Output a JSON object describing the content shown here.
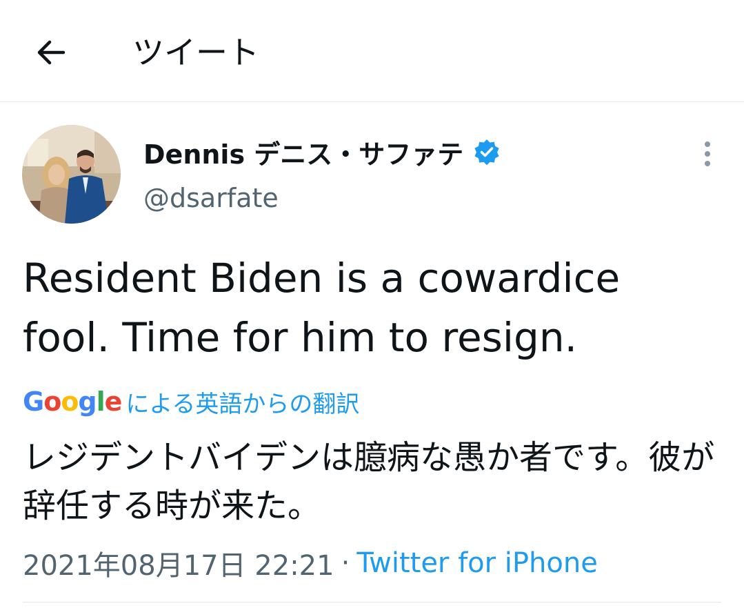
{
  "header": {
    "title": "ツイート",
    "back_icon": "arrow-left-icon"
  },
  "tweet": {
    "author_name": "Dennis  デニス・サファテ",
    "handle": "@dsarfate",
    "verified": true,
    "text": "Resident Biden is a cowardice fool. Time for him to resign.",
    "translation": {
      "provider_logo": "Google",
      "label": "による英語からの翻訳",
      "text": "レジデントバイデンは臆病な愚か者です。彼が辞任する時が来た。"
    },
    "timestamp": "2021年08月17日 22:21",
    "separator": "·",
    "source": "Twitter for iPhone"
  },
  "colors": {
    "accent": "#1d9bf0",
    "secondary_text": "#536471",
    "primary_text": "#0f1419",
    "divider": "#e1e6ea"
  }
}
